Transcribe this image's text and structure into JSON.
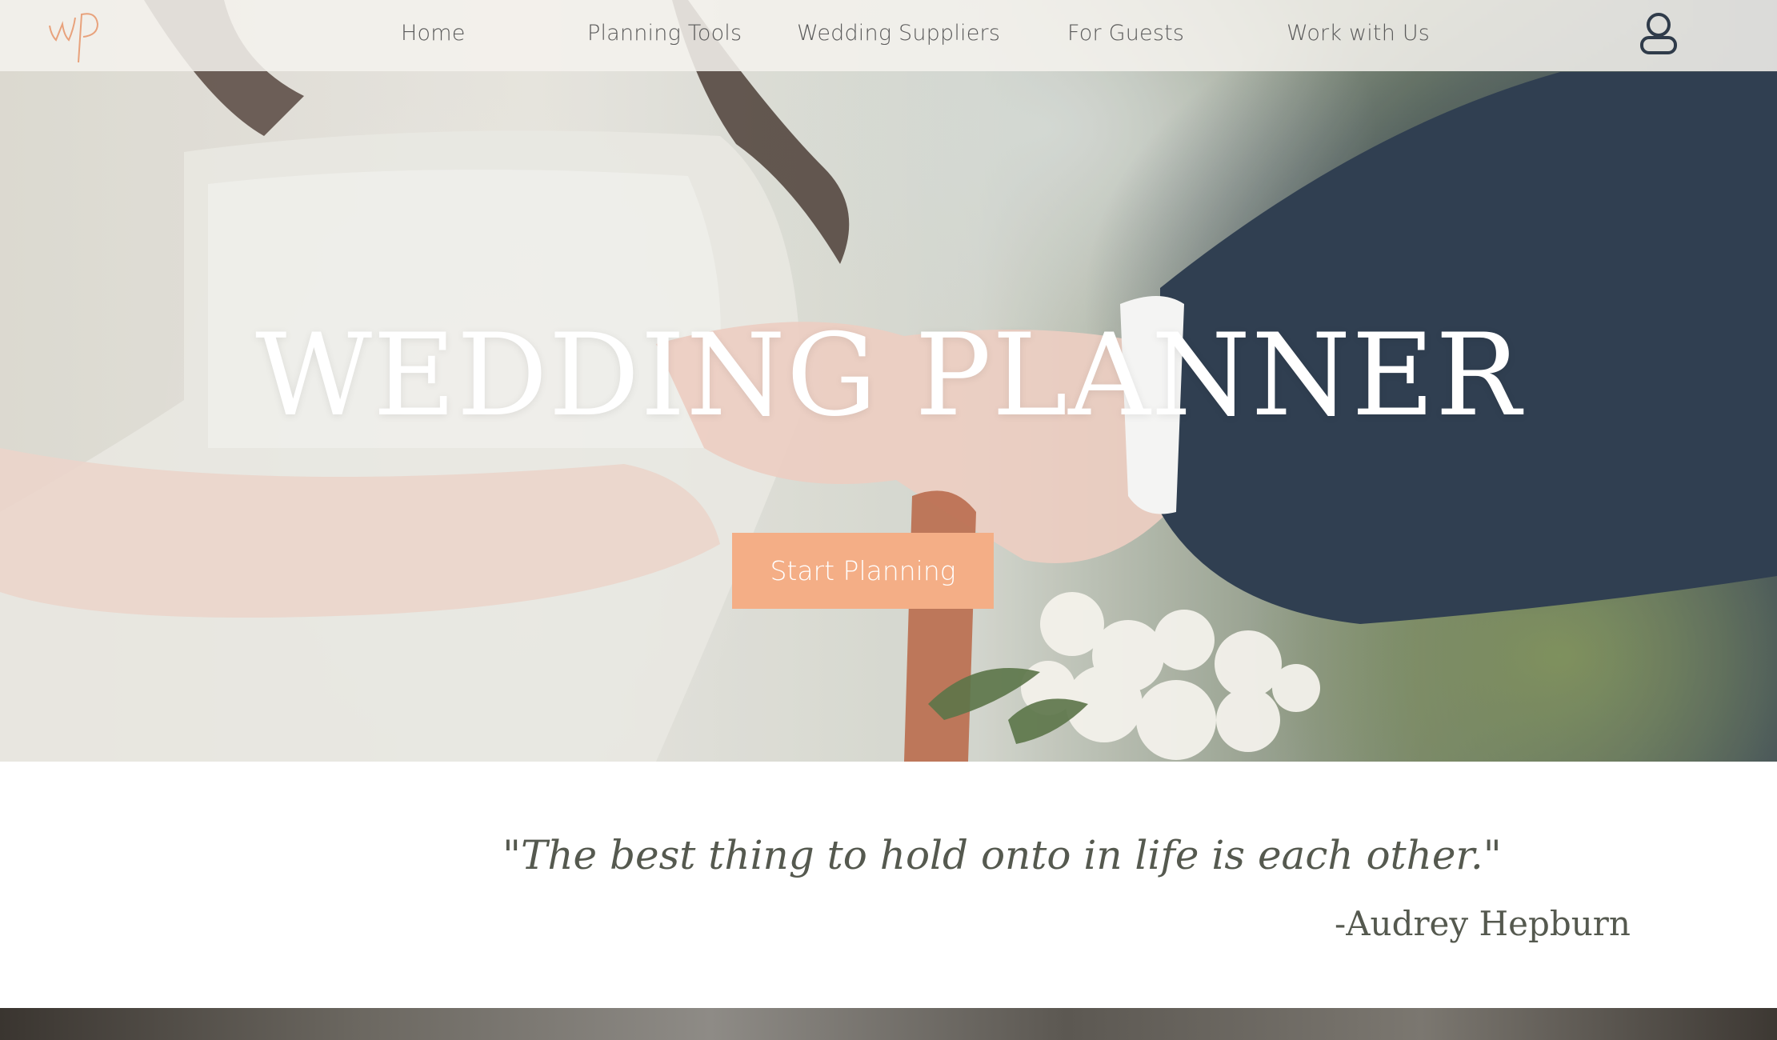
{
  "nav": {
    "logo_text": "wp",
    "items": [
      {
        "label": "Home"
      },
      {
        "label": "Planning Tools"
      },
      {
        "label": "Wedding Suppliers"
      },
      {
        "label": "For Guests"
      },
      {
        "label": "Work with Us"
      }
    ],
    "account_icon": "user-account-icon"
  },
  "hero": {
    "title": "WEDDING PLANNER",
    "cta_label": "Start Planning",
    "image": "bride-and-groom-ring-exchange-photo"
  },
  "quote": {
    "text": "\"The best thing to hold onto in life is each other.\"",
    "author": "-Audrey Hepburn"
  },
  "colors": {
    "accent": "#f4ae86",
    "nav_text": "#5a5a5a",
    "quote_text": "#55594f",
    "logo": "#e8a27c"
  }
}
